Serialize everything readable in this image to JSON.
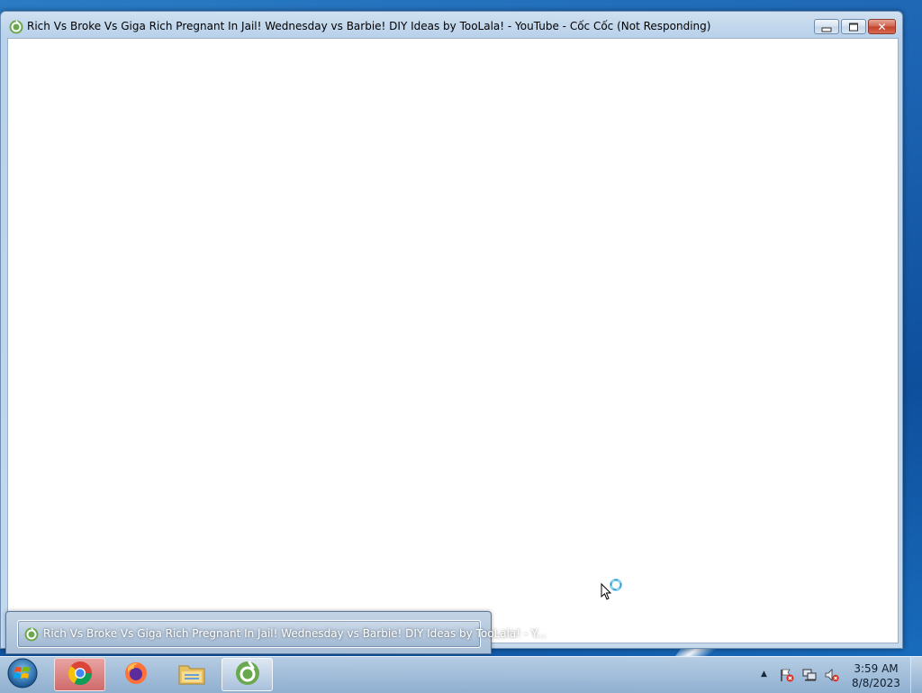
{
  "window": {
    "title": "Rich Vs Broke Vs Giga Rich Pregnant In Jail! Wednesday vs Barbie! DIY Ideas by TooLala! - YouTube - Cốc Cốc (Not Responding)",
    "app_icon": "coccoc-icon",
    "controls": [
      "minimize-icon",
      "maximize-icon",
      "close-icon"
    ]
  },
  "thumbnail": {
    "label": "Rich Vs Broke Vs Giga Rich Pregnant In Jail! Wednesday vs Barbie! DIY Ideas by TooLala! - Y..."
  },
  "taskbar": {
    "start": "windows-start-icon",
    "pinned": [
      {
        "name": "chrome-icon"
      },
      {
        "name": "firefox-icon"
      },
      {
        "name": "file-explorer-icon"
      },
      {
        "name": "coccoc-icon",
        "active": true
      }
    ],
    "tray": [
      "show-hidden-icons",
      "action-center-flag-icon",
      "network-icon",
      "volume-muted-icon"
    ],
    "clock": {
      "time": "3:59 AM",
      "date": "8/8/2023"
    }
  },
  "colors": {
    "desktop": "#1c64b3",
    "window_frame": "#b9d1ea",
    "close_button": "#c3402b",
    "coccoc_green": "#6aa84f"
  }
}
